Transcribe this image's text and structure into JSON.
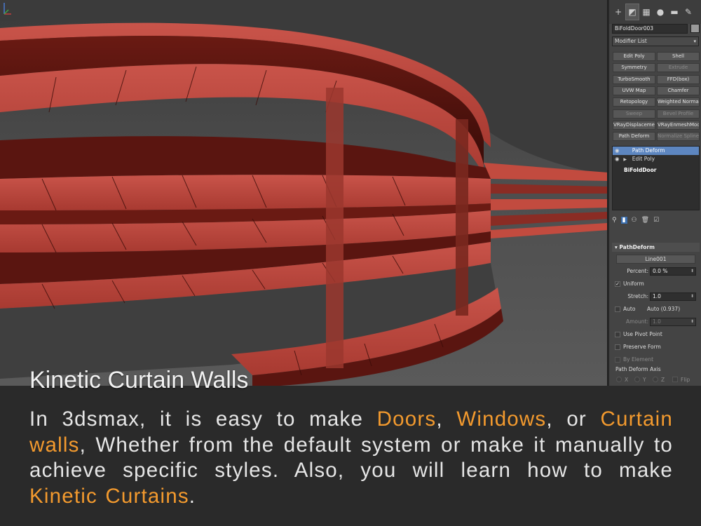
{
  "viewport": {
    "model_color": "#c24b3f",
    "model_shadow_color": "#5a1510"
  },
  "panel": {
    "tabs": [
      "plus-icon",
      "modify-icon",
      "hierarchy-icon",
      "motion-icon",
      "display-icon",
      "utilities-icon"
    ],
    "object_name": "BiFoldDoor003",
    "modifier_list_label": "Modifier List",
    "modifier_buttons": [
      {
        "label": "Edit Poly",
        "enabled": true
      },
      {
        "label": "Shell",
        "enabled": true
      },
      {
        "label": "Symmetry",
        "enabled": true
      },
      {
        "label": "Extrude",
        "enabled": false
      },
      {
        "label": "TurboSmooth",
        "enabled": true
      },
      {
        "label": "FFD(box)",
        "enabled": true
      },
      {
        "label": "UVW Map",
        "enabled": true
      },
      {
        "label": "Chamfer",
        "enabled": true
      },
      {
        "label": "Retopology",
        "enabled": true
      },
      {
        "label": "Weighted Normals",
        "enabled": true
      },
      {
        "label": "Sweep",
        "enabled": false
      },
      {
        "label": "Bevel Profile",
        "enabled": false
      },
      {
        "label": "VRayDisplacemen",
        "enabled": true
      },
      {
        "label": "VRayEnmeshMod",
        "enabled": true
      },
      {
        "label": "Path Deform",
        "enabled": true
      },
      {
        "label": "Normalize Spline",
        "enabled": false
      }
    ],
    "stack": {
      "items": [
        {
          "label": "Path Deform",
          "selected": true
        },
        {
          "label": "Edit Poly",
          "selected": false
        }
      ],
      "base_object": "BiFoldDoor"
    },
    "rollout": {
      "title": "PathDeform",
      "path_button": "Line001",
      "percent_label": "Percent:",
      "percent_value": "0.0 %",
      "uniform_label": "Uniform",
      "uniform_checked": true,
      "stretch_label": "Stretch:",
      "stretch_value": "1.0",
      "auto_label": "Auto",
      "auto_value_label": "Auto (0.937)",
      "amount_label": "Amount:",
      "amount_value": "1.0",
      "use_pivot_label": "Use Pivot Point",
      "preserve_form_label": "Preserve Form",
      "by_element_label": "By Element",
      "axis_group_label": "Path Deform Axis",
      "axis_options": [
        "X",
        "Y",
        "Z"
      ],
      "flip_label": "Flip"
    }
  },
  "caption": {
    "title": "Kinetic Curtain Walls",
    "segments": [
      {
        "text": "In 3dsmax, it is easy to make ",
        "highlight": false
      },
      {
        "text": "Doors",
        "highlight": true
      },
      {
        "text": ", ",
        "highlight": false
      },
      {
        "text": "Windows",
        "highlight": true
      },
      {
        "text": ", or ",
        "highlight": false
      },
      {
        "text": "Curtain walls",
        "highlight": true
      },
      {
        "text": ", Whether from the default system or make it manually to achieve specific styles. Also, you will learn how to make ",
        "highlight": false
      },
      {
        "text": "Kinetic Curtains",
        "highlight": true
      },
      {
        "text": ".",
        "highlight": false
      }
    ],
    "highlight_color": "#f39a2e"
  }
}
